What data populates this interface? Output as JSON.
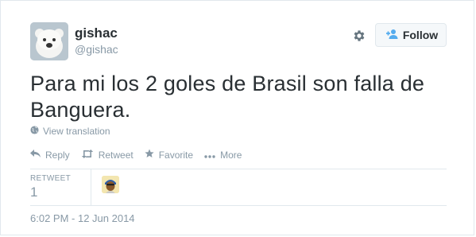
{
  "user": {
    "fullname": "gishac",
    "handle": "@gishac"
  },
  "follow_button": {
    "label": "Follow"
  },
  "tweet": {
    "text": "Para mi los 2 goles de Brasil son falla de Banguera."
  },
  "view_translation": "View translation",
  "actions": {
    "reply": "Reply",
    "retweet": "Retweet",
    "favorite": "Favorite",
    "more": "More"
  },
  "stats": {
    "retweet_label": "RETWEET",
    "retweet_count": "1"
  },
  "timestamp": "6:02 PM - 12 Jun 2014",
  "icons": {
    "gear": "gear-icon",
    "follow": "add-person-icon",
    "globe": "globe-icon",
    "reply": "reply-icon",
    "retweet": "retweet-icon",
    "favorite": "star-icon",
    "more": "more-dots-icon"
  },
  "colors": {
    "text": "#292f33",
    "muted": "#8899a6",
    "link": "#2b7bb9",
    "border": "#e1e8ed"
  }
}
